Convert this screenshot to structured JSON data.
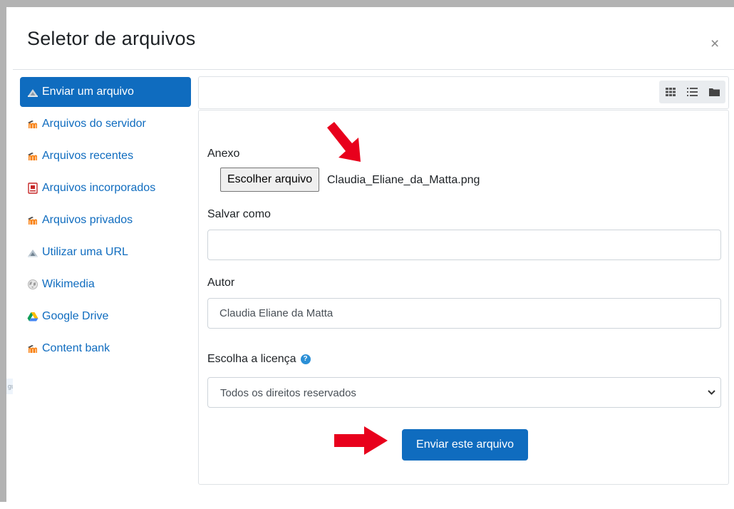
{
  "dialog": {
    "title": "Seletor de arquivos",
    "close_glyph": "×"
  },
  "background": {
    "ghost_text": "gular"
  },
  "sidebar": {
    "items": [
      {
        "label": "Enviar um arquivo",
        "icon": "upload-icon",
        "active": true
      },
      {
        "label": "Arquivos do servidor",
        "icon": "moodle-logo-icon"
      },
      {
        "label": "Arquivos recentes",
        "icon": "moodle-logo-icon"
      },
      {
        "label": "Arquivos incorporados",
        "icon": "embedded-files-icon"
      },
      {
        "label": "Arquivos privados",
        "icon": "moodle-logo-icon"
      },
      {
        "label": "Utilizar uma URL",
        "icon": "url-icon"
      },
      {
        "label": "Wikimedia",
        "icon": "wikimedia-globe-icon"
      },
      {
        "label": "Google Drive",
        "icon": "google-drive-icon"
      },
      {
        "label": "Content bank",
        "icon": "moodle-logo-icon"
      }
    ]
  },
  "toolbar": {
    "views": [
      "grid-view-icon",
      "list-view-icon",
      "folder-view-icon"
    ]
  },
  "form": {
    "attachment_label": "Anexo",
    "choose_file_button": "Escolher arquivo",
    "file_name": "Claudia_Eliane_da_Matta.png",
    "save_as_label": "Salvar como",
    "save_as_value": "",
    "author_label": "Autor",
    "author_value": "Claudia Eliane da Matta",
    "license_label": "Escolha a licença",
    "license_value": "Todos os direitos reservados",
    "submit_label": "Enviar este arquivo"
  },
  "colors": {
    "primary": "#0f6cbf",
    "annotation_arrow": "#e8001c"
  }
}
